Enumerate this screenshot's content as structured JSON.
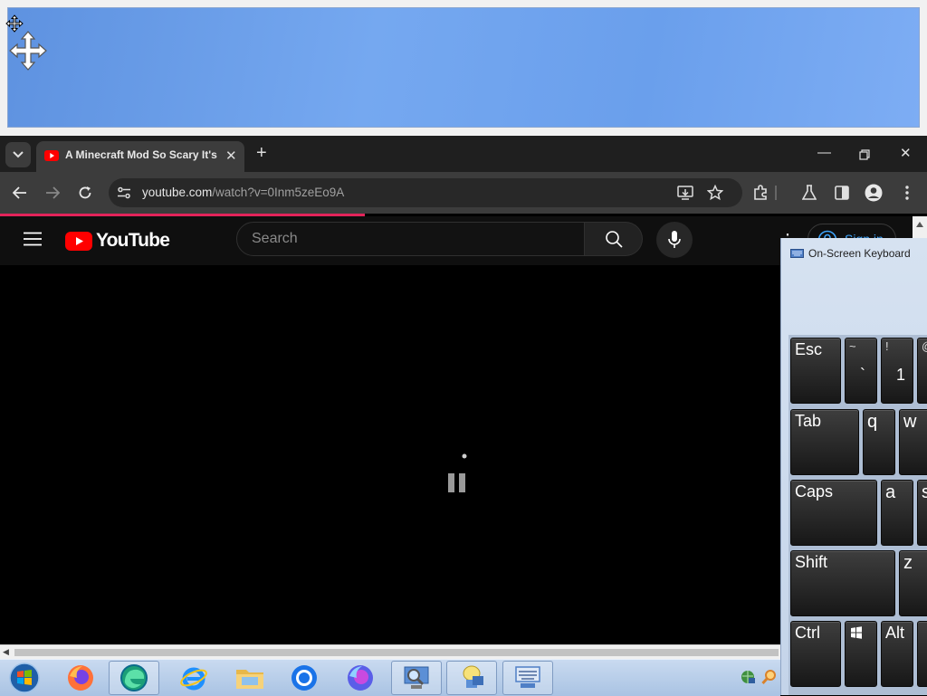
{
  "browser": {
    "tab_title": "A Minecraft Mod So Scary It's",
    "url_host": "youtube.com",
    "url_path": "/watch?v=0Inm5zeEo9A",
    "accent_red": "#ff0000",
    "progress_color": "#e3245a"
  },
  "youtube": {
    "logo_text": "YouTube",
    "search_placeholder": "Search",
    "sign_in_label": "Sign in"
  },
  "osk": {
    "title": "On-Screen Keyboard",
    "keys": {
      "esc": "Esc",
      "tilde_top": "~",
      "tilde_bottom": "`",
      "one_top": "!",
      "one_bottom": "1",
      "at_top": "@",
      "tab": "Tab",
      "q": "q",
      "w": "w",
      "caps": "Caps",
      "a": "a",
      "s": "s",
      "shift": "Shift",
      "z": "z",
      "ctrl": "Ctrl",
      "alt": "Alt"
    }
  },
  "taskbar": {
    "items": [
      "start-orb-icon",
      "firefox-icon",
      "edge-icon",
      "internet-explorer-icon",
      "file-explorer-icon",
      "chrome-icon",
      "firefox-dev-icon",
      "magnifier-app-icon",
      "user-accounts-icon",
      "on-screen-keyboard-icon"
    ]
  }
}
